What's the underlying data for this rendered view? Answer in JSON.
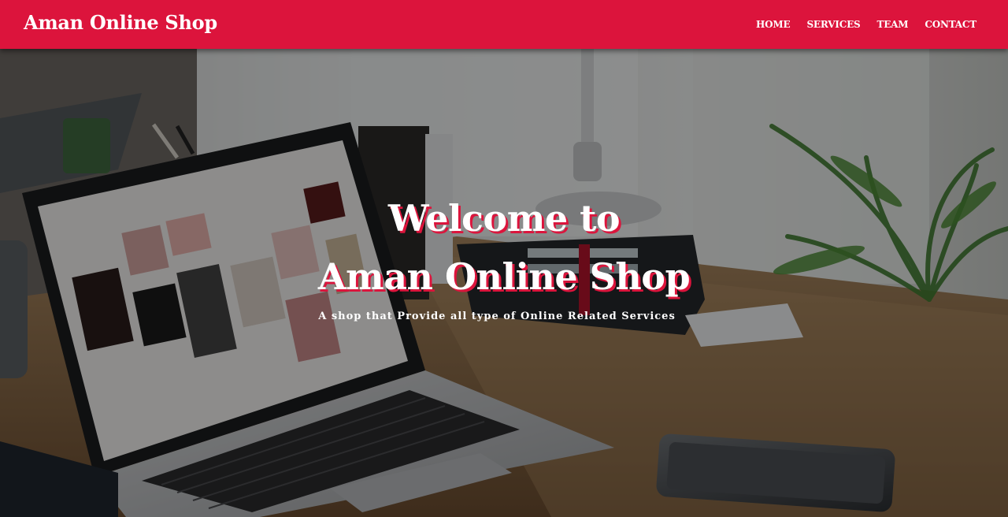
{
  "navbar": {
    "brand": "Aman Online Shop",
    "links": [
      {
        "label": "HOME"
      },
      {
        "label": "SERVICES"
      },
      {
        "label": "TEAM"
      },
      {
        "label": "CONTACT"
      }
    ],
    "background_color": "#dc143c"
  },
  "hero": {
    "heading_line1": "Welcome to",
    "heading_line2": "Aman Online Shop",
    "tagline": "A shop that Provide all type of Online Related Services",
    "text_shadow_color": "#dc143c",
    "background_image": "laptop-on-desk-photo"
  }
}
